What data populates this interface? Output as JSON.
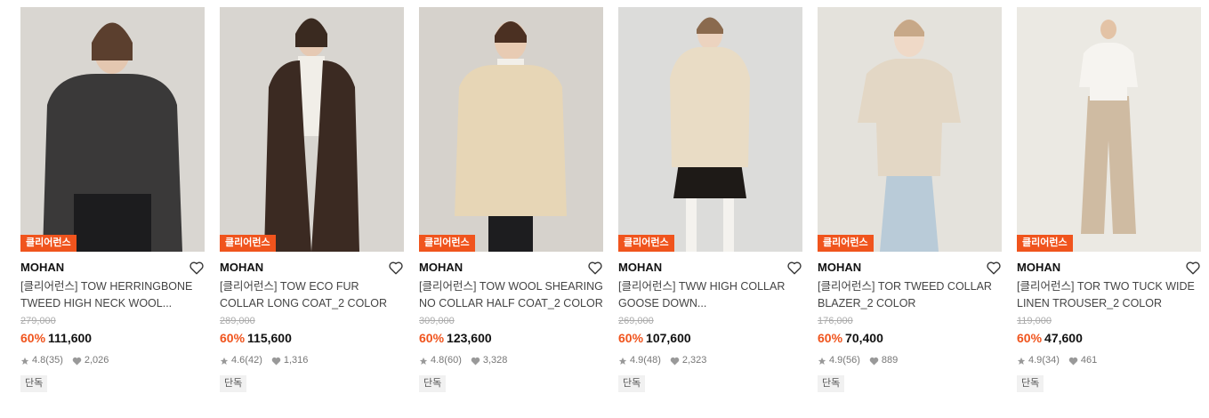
{
  "products": [
    {
      "tag": "클리어런스",
      "brand": "MOHAN",
      "title": "[클리어런스] TOW HERRINGBONE TWEED HIGH NECK WOOL...",
      "original_price": "279,000",
      "discount": "60%",
      "price": "111,600",
      "rating": "4.8",
      "reviews": "(35)",
      "likes": "2,026",
      "badge": "단독",
      "colors": {
        "bg": "#d9d6d1",
        "garment": "#3a3939",
        "bottom": "#1c1c1e"
      }
    },
    {
      "tag": "클리어런스",
      "brand": "MOHAN",
      "title": "[클리어런스] TOW ECO FUR COLLAR LONG COAT_2 COLOR",
      "original_price": "289,000",
      "discount": "60%",
      "price": "115,600",
      "rating": "4.6",
      "reviews": "(42)",
      "likes": "1,316",
      "badge": "단독",
      "colors": {
        "bg": "#d8d5d0",
        "garment": "#3b2a22",
        "bottom": "#2a1f1a"
      }
    },
    {
      "tag": "클리어런스",
      "brand": "MOHAN",
      "title": "[클리어런스] TOW WOOL SHEARING NO COLLAR HALF COAT_2 COLOR",
      "original_price": "309,000",
      "discount": "60%",
      "price": "123,600",
      "rating": "4.8",
      "reviews": "(60)",
      "likes": "3,328",
      "badge": "단독",
      "colors": {
        "bg": "#d6d2cc",
        "garment": "#e7d6b6",
        "bottom": "#1d1d1f"
      }
    },
    {
      "tag": "클리어런스",
      "brand": "MOHAN",
      "title": "[클리어런스] TWW HIGH COLLAR GOOSE DOWN...",
      "original_price": "269,000",
      "discount": "60%",
      "price": "107,600",
      "rating": "4.9",
      "reviews": "(48)",
      "likes": "2,323",
      "badge": "단독",
      "colors": {
        "bg": "#dcdcda",
        "garment": "#e9dcc5",
        "bottom": "#1e1a17"
      }
    },
    {
      "tag": "클리어런스",
      "brand": "MOHAN",
      "title": "[클리어런스] TOR TWEED COLLAR BLAZER_2 COLOR",
      "original_price": "176,000",
      "discount": "60%",
      "price": "70,400",
      "rating": "4.9",
      "reviews": "(56)",
      "likes": "889",
      "badge": "단독",
      "colors": {
        "bg": "#e4e2dc",
        "garment": "#e3d7c5",
        "bottom": "#b9cbd8"
      }
    },
    {
      "tag": "클리어런스",
      "brand": "MOHAN",
      "title": "[클리어런스] TOR TWO TUCK WIDE LINEN TROUSER_2 COLOR",
      "original_price": "119,000",
      "discount": "60%",
      "price": "47,600",
      "rating": "4.9",
      "reviews": "(34)",
      "likes": "461",
      "badge": "단독",
      "colors": {
        "bg": "#ebe9e3",
        "garment": "#f6f4f0",
        "bottom": "#cfbba2"
      }
    }
  ],
  "accent_color": "#f0541d"
}
